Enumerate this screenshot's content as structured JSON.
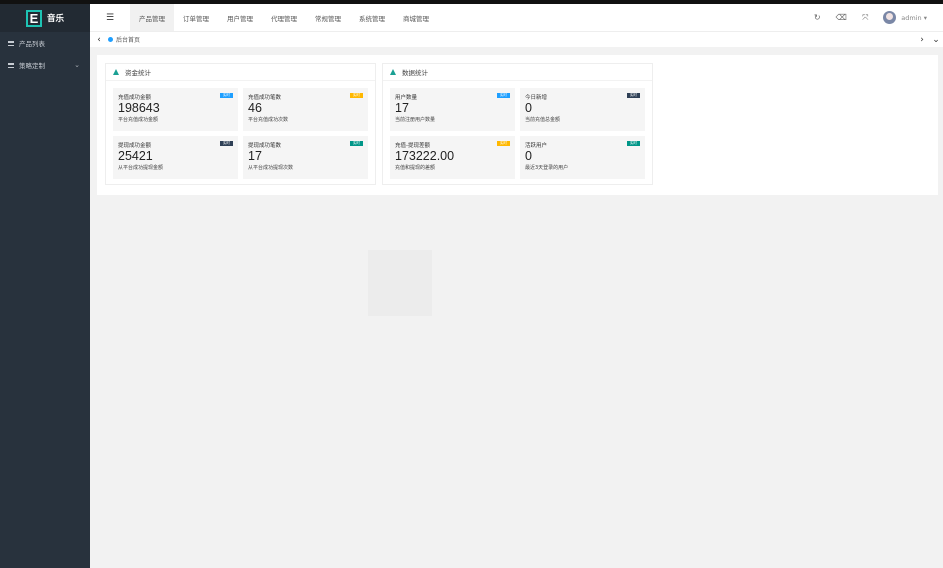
{
  "app": {
    "logo_letter": "E",
    "title": "音乐"
  },
  "sidebar": {
    "items": [
      {
        "label": "产品列表",
        "icon": "list-icon"
      },
      {
        "label": "策略定制",
        "icon": "list-icon",
        "has_submenu": true
      }
    ]
  },
  "header": {
    "menu_toggle_icon": "menu-icon",
    "nav": [
      {
        "label": "产品管理",
        "active": true
      },
      {
        "label": "订单管理"
      },
      {
        "label": "用户管理"
      },
      {
        "label": "代理管理"
      },
      {
        "label": "常规管理"
      },
      {
        "label": "系统管理"
      },
      {
        "label": "商城管理"
      }
    ],
    "icons": [
      "refresh-icon",
      "clear-icon",
      "fullscreen-icon"
    ],
    "user": "admin"
  },
  "tabs": {
    "home_label": "后台首页"
  },
  "panels": [
    {
      "title": "资金统计",
      "cards": [
        {
          "label": "充值成功金额",
          "value": "198643",
          "sub": "平台充值成功金额",
          "badge": "实时",
          "badge_color": "#1e9fff"
        },
        {
          "label": "充值成功笔数",
          "value": "46",
          "sub": "平台充值成功次数",
          "badge": "实时",
          "badge_color": "#ffb800"
        },
        {
          "label": "提现成功金额",
          "value": "25421",
          "sub": "从平台成功提现金额",
          "badge": "实时",
          "badge_color": "#2f4056"
        },
        {
          "label": "提现成功笔数",
          "value": "17",
          "sub": "从平台成功提现次数",
          "badge": "实时",
          "badge_color": "#009688"
        }
      ]
    },
    {
      "title": "数据统计",
      "cards": [
        {
          "label": "用户数量",
          "value": "17",
          "sub": "当前注册用户数量",
          "badge": "实时",
          "badge_color": "#1e9fff"
        },
        {
          "label": "今日新增",
          "value": "0",
          "sub": "当前充值总金额",
          "badge": "实时",
          "badge_color": "#2f4056"
        },
        {
          "label": "充值-提现差额",
          "value": "173222.00",
          "sub": "充值和提现的差额",
          "badge": "实时",
          "badge_color": "#ffb800"
        },
        {
          "label": "活跃用户",
          "value": "0",
          "sub": "最近3天登录的用户",
          "badge": "实时",
          "badge_color": "#009688"
        }
      ]
    }
  ]
}
